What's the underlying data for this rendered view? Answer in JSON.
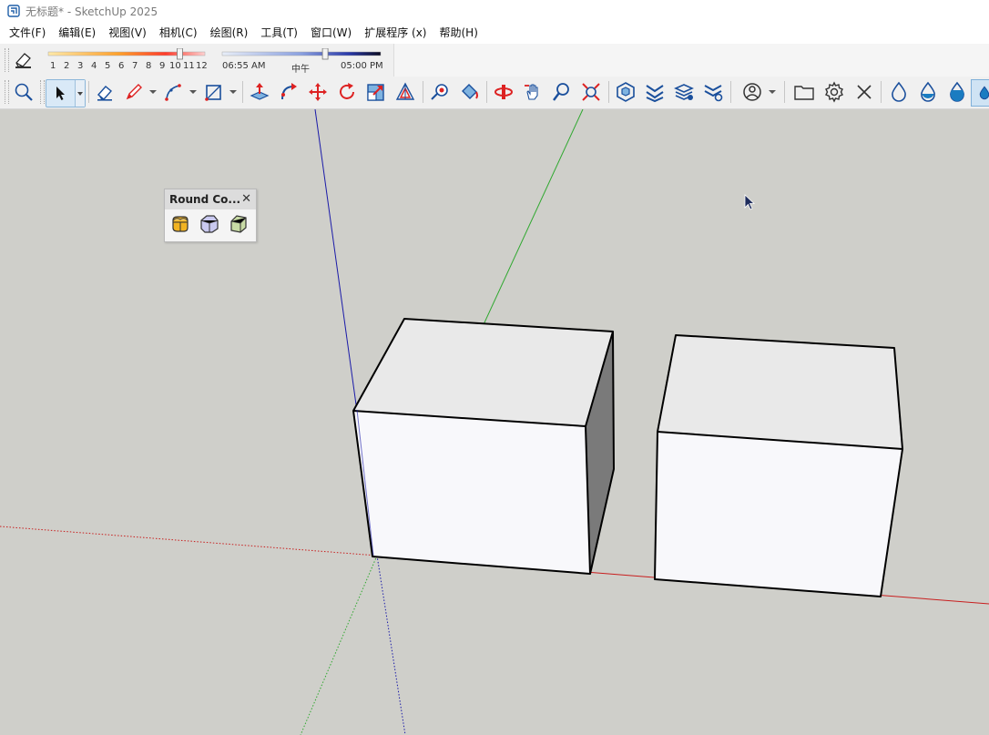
{
  "window": {
    "title": "无标题* - SketchUp 2025"
  },
  "menubar": {
    "items": [
      "文件(F)",
      "编辑(E)",
      "视图(V)",
      "相机(C)",
      "绘图(R)",
      "工具(T)",
      "窗口(W)",
      "扩展程序 (x)",
      "帮助(H)"
    ]
  },
  "shadows": {
    "month_ticks": [
      "1",
      "2",
      "3",
      "4",
      "5",
      "6",
      "7",
      "8",
      "9",
      "10",
      "11",
      "12"
    ],
    "time_start": "06:55 AM",
    "time_mid": "中午",
    "time_end": "05:00 PM",
    "month_slider_position": 0.84,
    "time_slider_position": 0.65
  },
  "round_corner_panel": {
    "title": "Round Co...",
    "close_glyph": "✕"
  },
  "colors": {
    "viewport_bg": "#cfcfca",
    "blue_axis": "#1a1aa8",
    "green_axis": "#2fa82f",
    "red_axis": "#c81e1e",
    "accent_blue": "#1a7cc1"
  }
}
